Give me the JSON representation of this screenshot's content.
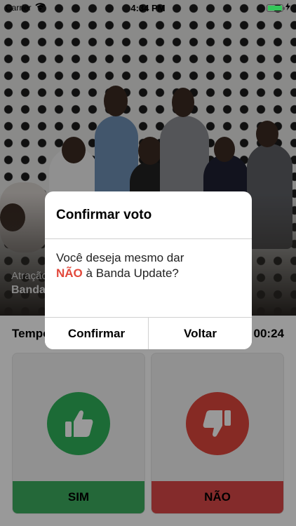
{
  "status_bar": {
    "carrier": "Carrier",
    "time": "4:34 PM",
    "battery_level": 1.0,
    "battery_color": "#34c759"
  },
  "hero": {
    "attraction_label": "Atração",
    "band_name": "Banda"
  },
  "timer": {
    "label": "Tempo",
    "value": "00:24"
  },
  "vote": {
    "yes_label": "SIM",
    "no_label": "NÃO",
    "yes_icon": "thumbs-up-icon",
    "no_icon": "thumbs-down-icon",
    "yes_color": "#2fb35a",
    "no_color": "#e0463c"
  },
  "dialog": {
    "title": "Confirmar voto",
    "message_prefix": "Você deseja mesmo dar",
    "message_highlight": "NÃO",
    "message_suffix": "à Banda Update?",
    "confirm_label": "Confirmar",
    "back_label": "Voltar",
    "highlight_color": "#e2493c"
  }
}
